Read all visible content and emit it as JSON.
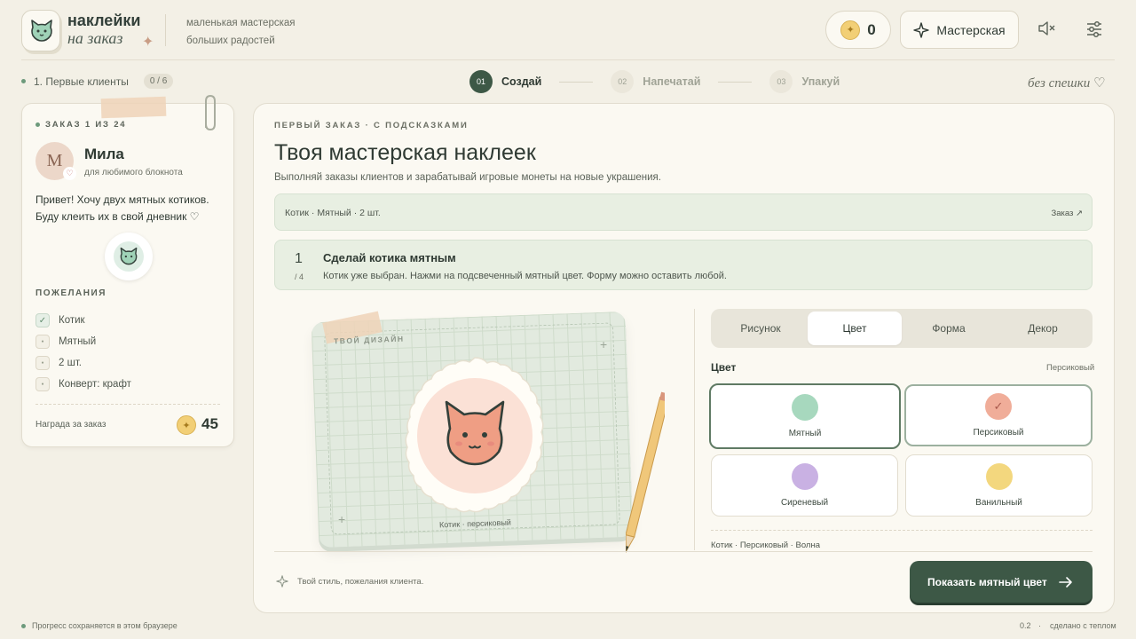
{
  "brand": {
    "line1": "наклейки",
    "line2": "на заказ",
    "tagline1": "маленькая мастерская",
    "tagline2": "больших радостей"
  },
  "header": {
    "coins": "0",
    "workshop_label": "Мастерская",
    "mute_icon": "speaker-mute-icon",
    "settings_icon": "sliders-icon"
  },
  "progress": {
    "level_label": "1. Первые клиенты",
    "level_count": "0 / 6",
    "steps": [
      {
        "num": "01",
        "label": "Создай"
      },
      {
        "num": "02",
        "label": "Напечатай"
      },
      {
        "num": "03",
        "label": "Упакуй"
      }
    ],
    "mood": "без спешки ♡"
  },
  "order": {
    "header": "ЗАКАЗ 1 ИЗ 24",
    "avatar_letter": "М",
    "client_name": "Мила",
    "client_sub": "для любимого блокнота",
    "message": "Привет! Хочу двух мятных котиков. Буду клеить их в свой дневник ♡",
    "wishes_label": "ПОЖЕЛАНИЯ",
    "wishes": [
      {
        "label": "Котик",
        "done": true
      },
      {
        "label": "Мятный",
        "done": false
      },
      {
        "label": "2 шт.",
        "done": false
      },
      {
        "label": "Конверт: крафт",
        "done": false
      }
    ],
    "reward_label": "Награда за заказ",
    "reward_value": "45"
  },
  "main": {
    "kicker": "ПЕРВЫЙ ЗАКАЗ · С ПОДСКАЗКАМИ",
    "title": "Твоя мастерская наклеек",
    "description": "Выполняй заказы клиентов и зарабатывай игровые монеты на новые украшения.",
    "order_summary": "Котик · Мятный · 2 шт.",
    "order_link": "Заказ ↗",
    "task": {
      "num": "1",
      "of": "/ 4",
      "title": "Сделай котика мятным",
      "text": "Котик уже выбран. Нажми на подсвеченный мятный цвет. Форму можно оставить любой."
    },
    "design_label": "ТВОЙ ДИЗАЙН",
    "sticker_caption": "Котик · персиковый"
  },
  "editor": {
    "tabs": [
      "Рисунок",
      "Цвет",
      "Форма",
      "Декор"
    ],
    "selected_tab": "Цвет",
    "color_heading": "Цвет",
    "current_color": "Персиковый",
    "colors": [
      {
        "name": "Мятный",
        "hex": "#a7d8be"
      },
      {
        "name": "Персиковый",
        "hex": "#f0ad99"
      },
      {
        "name": "Сиреневый",
        "hex": "#c9b1e3"
      },
      {
        "name": "Ванильный",
        "hex": "#f3d77e"
      }
    ],
    "summary": "Котик · Персиковый · Волна"
  },
  "footer": {
    "hint": "Твой стиль, пожелания клиента.",
    "cta": "Показать мятный цвет",
    "saved": "Прогресс сохраняется в этом браузере",
    "version": "0.2",
    "made": "сделано с теплом"
  },
  "colors": {
    "accent": "#3d5846",
    "mint_panel": "#e8efe2",
    "background": "#f3f0e6"
  }
}
